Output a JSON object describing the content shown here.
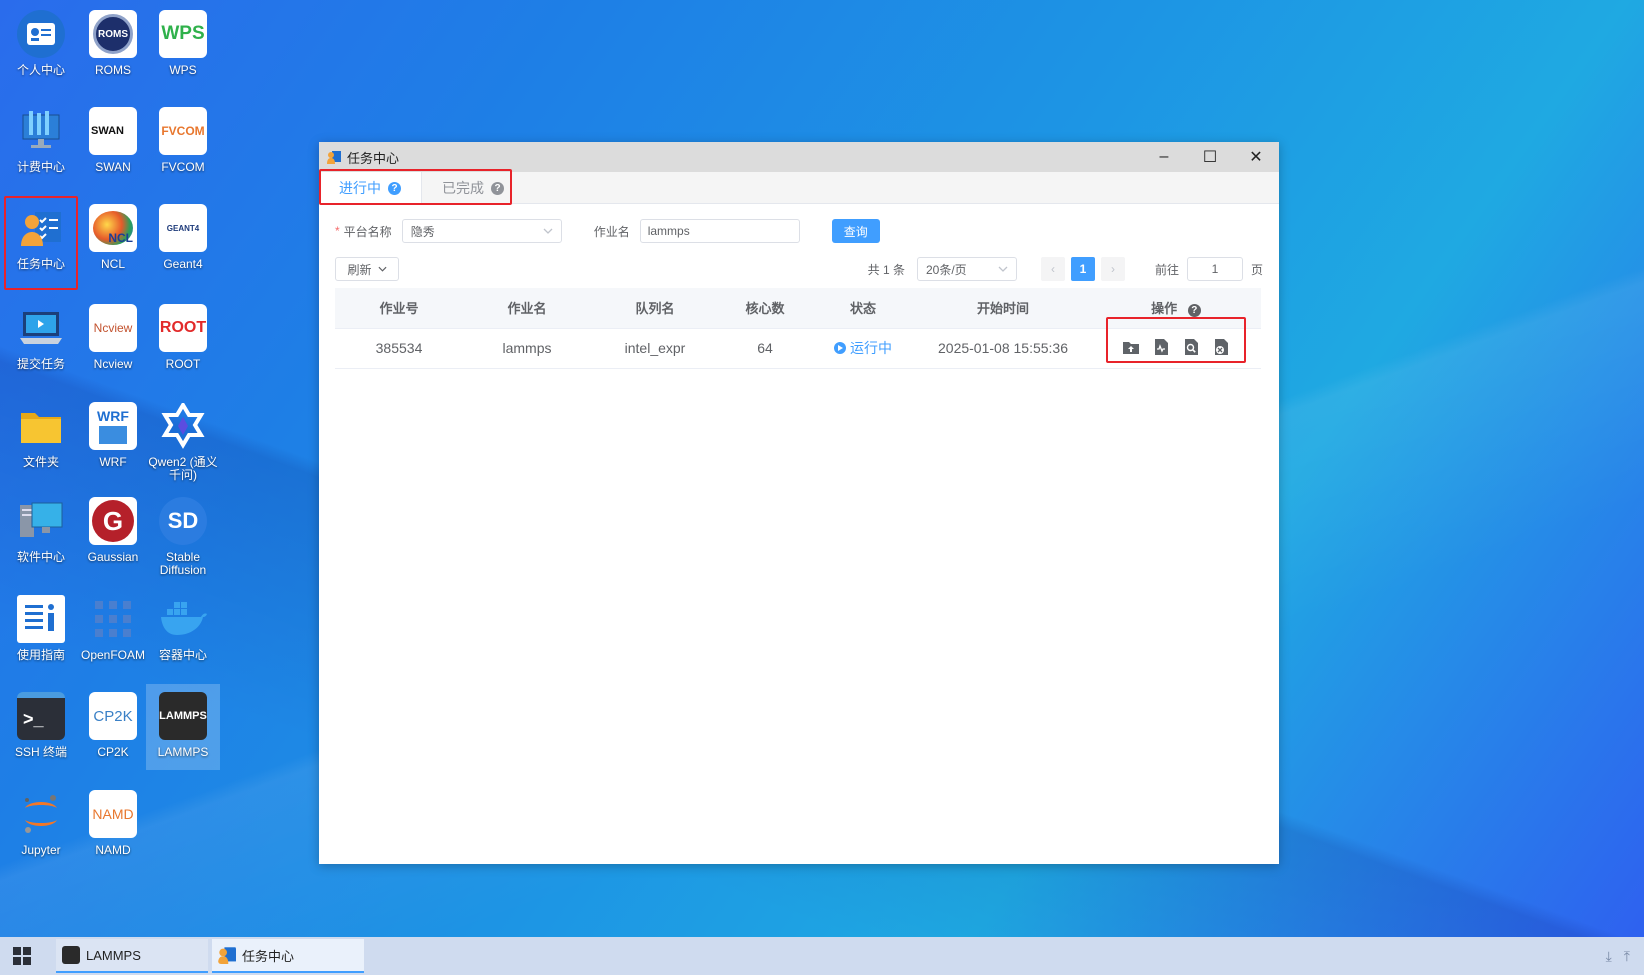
{
  "desktop": {
    "icons": [
      {
        "label": "个人中心",
        "glyph": "ID"
      },
      {
        "label": "ROMS",
        "glyph": "ROMS"
      },
      {
        "label": "WPS",
        "glyph": "WPS"
      },
      {
        "label": "计费中心",
        "glyph": ""
      },
      {
        "label": "SWAN",
        "glyph": "SWAN"
      },
      {
        "label": "FVCOM",
        "glyph": "FVCOM"
      },
      {
        "label": "任务中心",
        "glyph": ""
      },
      {
        "label": "NCL",
        "glyph": "NCL"
      },
      {
        "label": "Geant4",
        "glyph": "GEANT4"
      },
      {
        "label": "提交任务",
        "glyph": ""
      },
      {
        "label": "Ncview",
        "glyph": "Ncview"
      },
      {
        "label": "ROOT",
        "glyph": "ROOT"
      },
      {
        "label": "文件夹",
        "glyph": ""
      },
      {
        "label": "WRF",
        "glyph": "WRF"
      },
      {
        "label": "Qwen2 (通义千问)",
        "glyph": ""
      },
      {
        "label": "软件中心",
        "glyph": ""
      },
      {
        "label": "Gaussian",
        "glyph": "G"
      },
      {
        "label": "Stable Diffusion",
        "glyph": "SD"
      },
      {
        "label": "使用指南",
        "glyph": ""
      },
      {
        "label": "OpenFOAM",
        "glyph": ""
      },
      {
        "label": "容器中心",
        "glyph": ""
      },
      {
        "label": "SSH 终端",
        "glyph": ">_"
      },
      {
        "label": "CP2K",
        "glyph": "CP2K"
      },
      {
        "label": "LAMMPS",
        "glyph": "LAMMPS"
      },
      {
        "label": "Jupyter",
        "glyph": ""
      },
      {
        "label": "NAMD",
        "glyph": "NAMD"
      }
    ]
  },
  "window": {
    "title": "任务中心",
    "controls": {
      "minimize": "–",
      "maximize": "☐",
      "close": "✕"
    },
    "tabs": [
      {
        "label": "进行中",
        "help": "?"
      },
      {
        "label": "已完成",
        "help": "?"
      }
    ],
    "filters": {
      "required_mark": "*",
      "platform_label": "平台名称",
      "platform_value": "隐秀",
      "job_label": "作业名",
      "job_value": "lammps",
      "query_button": "查询"
    },
    "toolbar": {
      "refresh_label": "刷新",
      "total_text": "共 1 条",
      "page_size": "20条/页",
      "prev": "‹",
      "current_page": "1",
      "next": "›",
      "goto_label": "前往",
      "goto_value": "1",
      "page_suffix": "页"
    },
    "table": {
      "columns": [
        "作业号",
        "作业名",
        "队列名",
        "核心数",
        "状态",
        "开始时间",
        "操作"
      ],
      "ops_help": "?",
      "rows": [
        {
          "job_id": "385534",
          "job_name": "lammps",
          "queue": "intel_expr",
          "cores": "64",
          "status": "运行中",
          "start_time": "2025-01-08 15:55:36"
        }
      ]
    }
  },
  "taskbar": {
    "items": [
      {
        "label": "LAMMPS"
      },
      {
        "label": "任务中心"
      }
    ],
    "tray": {
      "download": "⤓",
      "upload": "⤒"
    }
  },
  "colors": {
    "accent": "#409eff",
    "highlight": "#e8232a"
  }
}
